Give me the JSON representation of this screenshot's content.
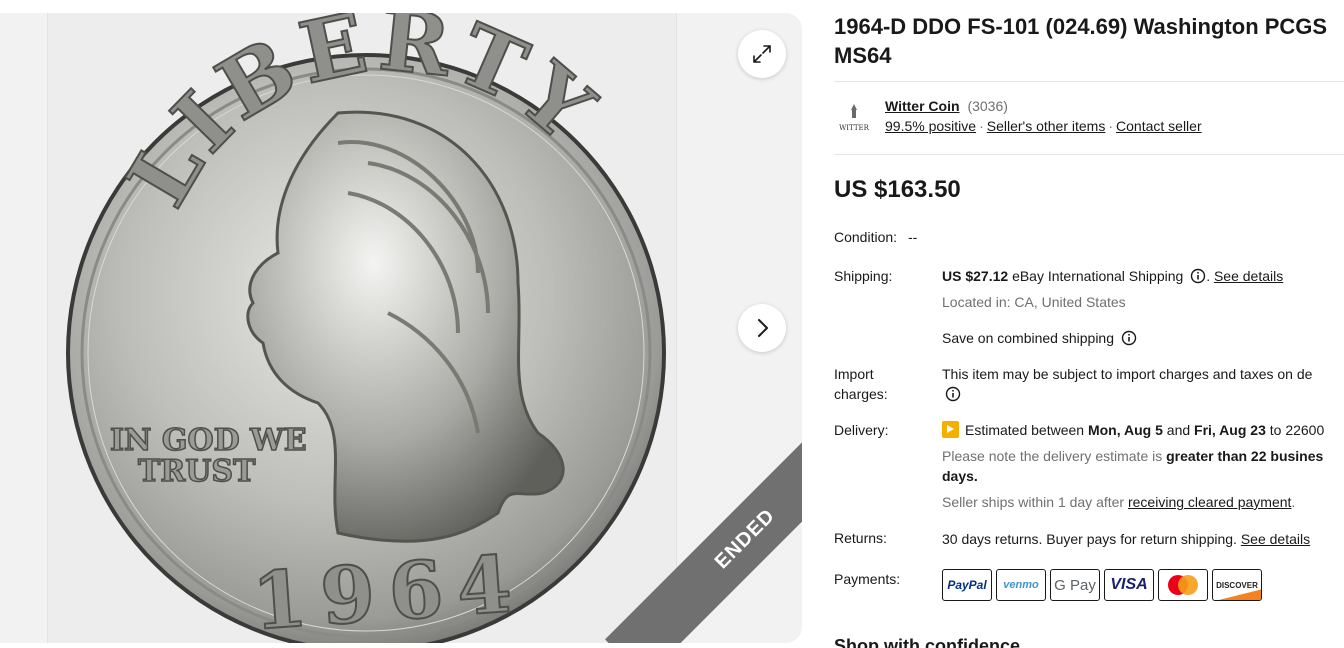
{
  "listing": {
    "title": "1964-D DDO FS-101 (024.69) Washington PCGS MS64",
    "status_ribbon": "ENDED",
    "price": "US $163.50"
  },
  "coin_image": {
    "legend_top": "LIBERTY",
    "motto_line1": "IN GOD WE",
    "motto_line2": "TRUST",
    "year": "1964"
  },
  "seller": {
    "logo_text": "WITTER",
    "name": "Witter Coin",
    "feedback_count": "(3036)",
    "positive": "99.5% positive",
    "other_items": "Seller's other items",
    "contact": "Contact seller",
    "separator": "·"
  },
  "details": {
    "condition_label": "Condition:",
    "condition_value": "--",
    "shipping_label": "Shipping:",
    "shipping_cost": "US $27.12",
    "shipping_service": "eBay International Shipping",
    "shipping_see_details": "See details",
    "shipping_period": ".",
    "located_in": "Located in: CA, United States",
    "combined_shipping": "Save on combined shipping",
    "import_label_1": "Import",
    "import_label_2": "charges:",
    "import_text": "This item may be subject to import charges and taxes on de",
    "delivery_label": "Delivery:",
    "delivery_pre": "Estimated between",
    "delivery_date1": "Mon, Aug 5",
    "delivery_and": "and",
    "delivery_date2": "Fri, Aug 23",
    "delivery_to": "to 22600",
    "delivery_note_pre": "Please note the delivery estimate is",
    "delivery_note_bold": "greater than 22 busines",
    "delivery_note_days": "days.",
    "ships_within_pre": "Seller ships within 1 day after",
    "ships_within_link": "receiving cleared payment",
    "ships_within_post": ".",
    "returns_label": "Returns:",
    "returns_text": "30 days returns. Buyer pays for return shipping.",
    "returns_see_details": "See details",
    "payments_label": "Payments:"
  },
  "payment_methods": {
    "paypal": "PayPal",
    "venmo": "venmo",
    "gpay": "G Pay",
    "visa": "VISA",
    "discover": "DISCOVER"
  },
  "shop_heading": "Shop with confidence",
  "colors": {
    "text": "#191919",
    "muted": "#707070",
    "ribbon": "#707070",
    "flag": "#f5af02",
    "gallery_bg": "#f2f2f2"
  },
  "icons": [
    "expand-icon",
    "chevron-right-icon",
    "info-icon",
    "delivery-flag-icon"
  ]
}
